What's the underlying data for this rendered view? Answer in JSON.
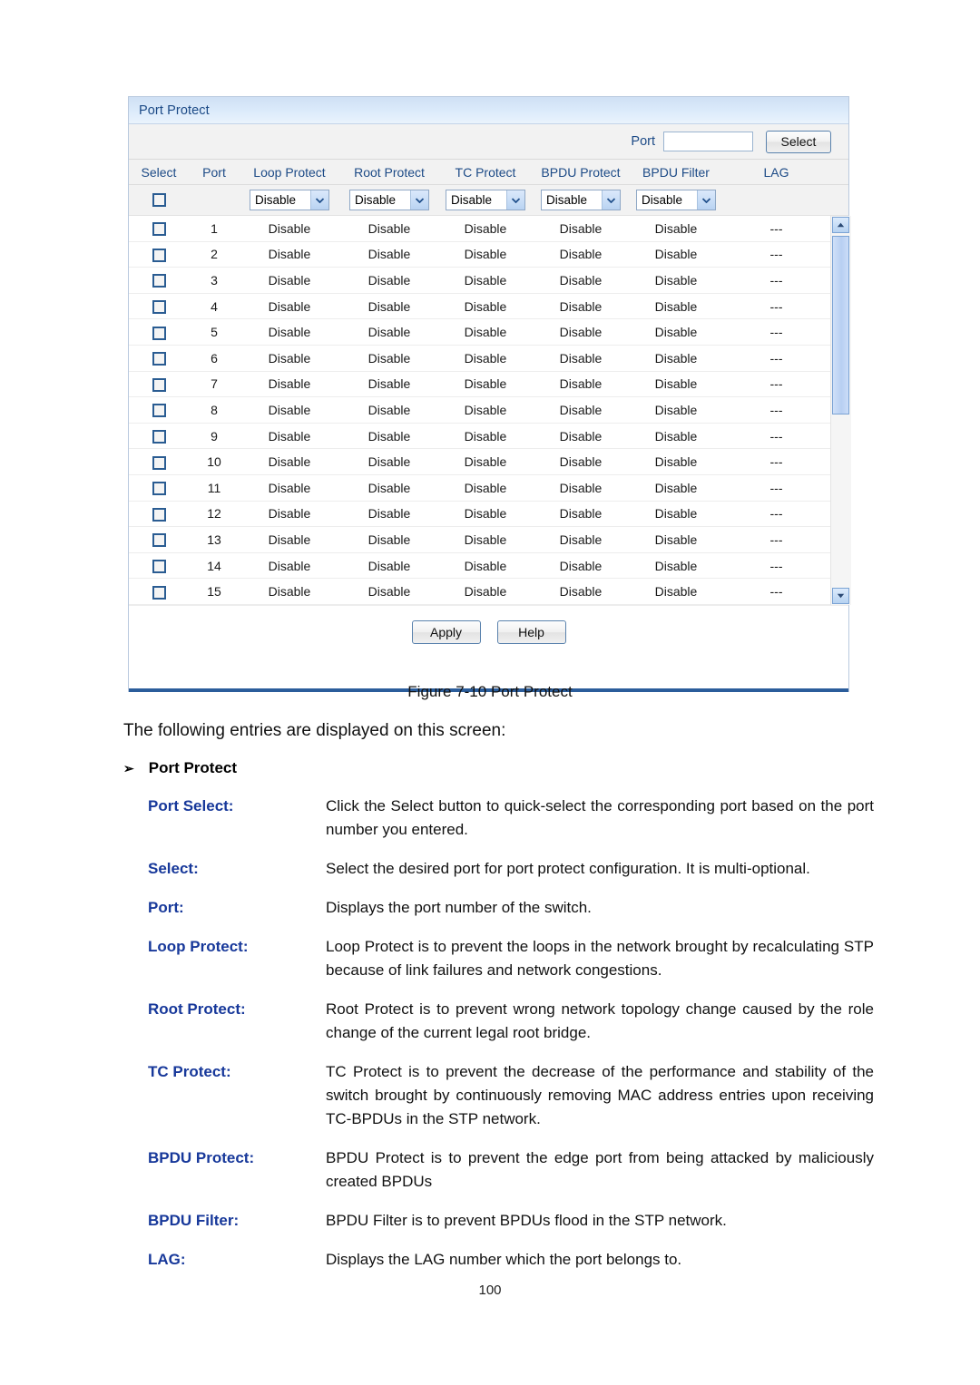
{
  "panel": {
    "title": "Port Protect",
    "search": {
      "label": "Port",
      "value": "",
      "placeholder": "",
      "button_label": "Select"
    },
    "columns": [
      "Select",
      "Port",
      "Loop Protect",
      "Root Protect",
      "TC Protect",
      "BPDU Protect",
      "BPDU Filter",
      "LAG"
    ],
    "bulk_dropdowns": [
      {
        "name": "loop-protect",
        "value": "Disable"
      },
      {
        "name": "root-protect",
        "value": "Disable"
      },
      {
        "name": "tc-protect",
        "value": "Disable"
      },
      {
        "name": "bpdu-protect",
        "value": "Disable"
      },
      {
        "name": "bpdu-filter",
        "value": "Disable"
      }
    ],
    "rows": [
      {
        "port": "1",
        "loop": "Disable",
        "root": "Disable",
        "tc": "Disable",
        "bpdu_protect": "Disable",
        "bpdu_filter": "Disable",
        "lag": "---"
      },
      {
        "port": "2",
        "loop": "Disable",
        "root": "Disable",
        "tc": "Disable",
        "bpdu_protect": "Disable",
        "bpdu_filter": "Disable",
        "lag": "---"
      },
      {
        "port": "3",
        "loop": "Disable",
        "root": "Disable",
        "tc": "Disable",
        "bpdu_protect": "Disable",
        "bpdu_filter": "Disable",
        "lag": "---"
      },
      {
        "port": "4",
        "loop": "Disable",
        "root": "Disable",
        "tc": "Disable",
        "bpdu_protect": "Disable",
        "bpdu_filter": "Disable",
        "lag": "---"
      },
      {
        "port": "5",
        "loop": "Disable",
        "root": "Disable",
        "tc": "Disable",
        "bpdu_protect": "Disable",
        "bpdu_filter": "Disable",
        "lag": "---"
      },
      {
        "port": "6",
        "loop": "Disable",
        "root": "Disable",
        "tc": "Disable",
        "bpdu_protect": "Disable",
        "bpdu_filter": "Disable",
        "lag": "---"
      },
      {
        "port": "7",
        "loop": "Disable",
        "root": "Disable",
        "tc": "Disable",
        "bpdu_protect": "Disable",
        "bpdu_filter": "Disable",
        "lag": "---"
      },
      {
        "port": "8",
        "loop": "Disable",
        "root": "Disable",
        "tc": "Disable",
        "bpdu_protect": "Disable",
        "bpdu_filter": "Disable",
        "lag": "---"
      },
      {
        "port": "9",
        "loop": "Disable",
        "root": "Disable",
        "tc": "Disable",
        "bpdu_protect": "Disable",
        "bpdu_filter": "Disable",
        "lag": "---"
      },
      {
        "port": "10",
        "loop": "Disable",
        "root": "Disable",
        "tc": "Disable",
        "bpdu_protect": "Disable",
        "bpdu_filter": "Disable",
        "lag": "---"
      },
      {
        "port": "11",
        "loop": "Disable",
        "root": "Disable",
        "tc": "Disable",
        "bpdu_protect": "Disable",
        "bpdu_filter": "Disable",
        "lag": "---"
      },
      {
        "port": "12",
        "loop": "Disable",
        "root": "Disable",
        "tc": "Disable",
        "bpdu_protect": "Disable",
        "bpdu_filter": "Disable",
        "lag": "---"
      },
      {
        "port": "13",
        "loop": "Disable",
        "root": "Disable",
        "tc": "Disable",
        "bpdu_protect": "Disable",
        "bpdu_filter": "Disable",
        "lag": "---"
      },
      {
        "port": "14",
        "loop": "Disable",
        "root": "Disable",
        "tc": "Disable",
        "bpdu_protect": "Disable",
        "bpdu_filter": "Disable",
        "lag": "---"
      },
      {
        "port": "15",
        "loop": "Disable",
        "root": "Disable",
        "tc": "Disable",
        "bpdu_protect": "Disable",
        "bpdu_filter": "Disable",
        "lag": "---"
      }
    ],
    "actions": {
      "apply_label": "Apply",
      "help_label": "Help"
    }
  },
  "document": {
    "figure_caption": "Figure 7-10 Port Protect",
    "intro": "The following entries are displayed on this screen:",
    "section_bullet": "➢",
    "section_heading": "Port Protect",
    "definitions": [
      {
        "term": "Port Select:",
        "desc": "Click the Select button to quick-select the corresponding port based on the port number you entered."
      },
      {
        "term": "Select:",
        "desc": "Select the desired port for port protect configuration. It is multi-optional."
      },
      {
        "term": "Port:",
        "desc": "Displays the port number of the switch."
      },
      {
        "term": "Loop Protect:",
        "desc": "Loop Protect is to prevent the loops in the network brought by recalculating STP because of link failures and network congestions."
      },
      {
        "term": "Root Protect:",
        "desc": "Root Protect is to prevent wrong network topology change caused by the role change of the current legal root bridge."
      },
      {
        "term": "TC Protect:",
        "desc": "TC Protect is to prevent the decrease of the performance and stability of the switch brought by continuously removing MAC address entries upon receiving TC-BPDUs in the STP network."
      },
      {
        "term": "BPDU Protect:",
        "desc": "BPDU Protect is to prevent the edge port from being attacked by maliciously created BPDUs"
      },
      {
        "term": "BPDU Filter:",
        "desc": "BPDU Filter is to prevent BPDUs flood in the STP network."
      },
      {
        "term": "LAG:",
        "desc": "Displays the LAG number which the port belongs to."
      }
    ],
    "page_number": "100"
  },
  "colors": {
    "panel_title_text": "#1c4a86",
    "panel_title_bg": "#d3e3f6",
    "header_text": "#1c4a86",
    "term_text": "#17389a",
    "rule": "#2b5d9b",
    "checkbox_border": "#2a5c92",
    "scrollbar": "#b8cff2"
  }
}
